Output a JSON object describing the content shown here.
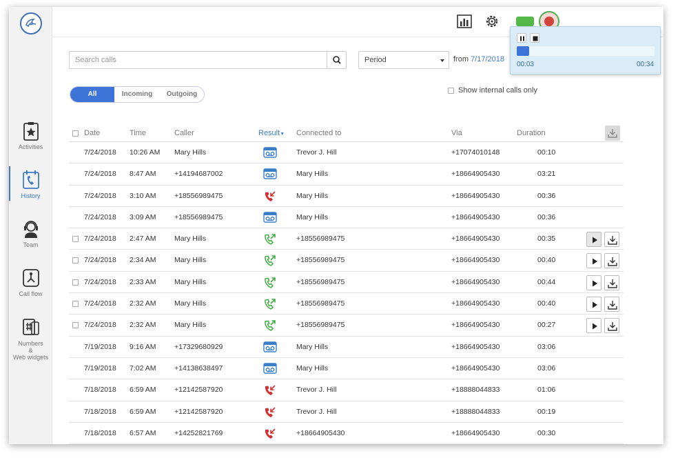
{
  "nav": [
    {
      "label": "Activities",
      "icon": "star-clipboard-icon"
    },
    {
      "label": "History",
      "icon": "phone-calendar-icon",
      "active": true
    },
    {
      "label": "Team",
      "icon": "headset-agent-icon"
    },
    {
      "label": "Call flow",
      "icon": "call-flow-icon"
    },
    {
      "label": "Numbers & Web widgets",
      "label_lines": [
        "Numbers",
        "&",
        "Web widgets"
      ],
      "icon": "hash-phone-icon"
    }
  ],
  "search": {
    "placeholder": "Search calls"
  },
  "period": {
    "label": "Period"
  },
  "from": {
    "prefix": "from",
    "date": "7/17/2018"
  },
  "tabs": {
    "all": "All",
    "incoming": "Incoming",
    "outgoing": "Outgoing"
  },
  "internal_only": "Show internal calls only",
  "columns": {
    "date": "Date",
    "time": "Time",
    "caller": "Caller",
    "result": "Result",
    "connected": "Connected to",
    "via": "Via",
    "duration": "Duration"
  },
  "player": {
    "current": "00:03",
    "total": "00:34",
    "progress": 0.09
  },
  "colors": {
    "accent": "#3e74d8",
    "voicemail": "#3a7dc9",
    "missed": "#d32f2f",
    "outgoing": "#3cae3f"
  },
  "rows": [
    {
      "date": "7/24/2018",
      "time": "10:26 AM",
      "caller": "Mary Hills",
      "result": "voicemail",
      "connected": "Trevor J. Hill",
      "via": "+17074010148",
      "duration": "00:10",
      "checkbox": false,
      "recording": false
    },
    {
      "date": "7/24/2018",
      "time": "8:47 AM",
      "caller": "+14194687002",
      "result": "voicemail",
      "connected": "Mary Hills",
      "via": "+18664905430",
      "duration": "03:21",
      "checkbox": false,
      "recording": false
    },
    {
      "date": "7/24/2018",
      "time": "3:10 AM",
      "caller": "+18556989475",
      "result": "missed",
      "connected": "Mary Hills",
      "via": "+18664905430",
      "duration": "00:36",
      "checkbox": false,
      "recording": false
    },
    {
      "date": "7/24/2018",
      "time": "3:09 AM",
      "caller": "+18556989475",
      "result": "voicemail",
      "connected": "Mary Hills",
      "via": "+18664905430",
      "duration": "00:36",
      "checkbox": false,
      "recording": false
    },
    {
      "date": "7/24/2018",
      "time": "2:47 AM",
      "caller": "Mary Hills",
      "result": "outgoing",
      "connected": "+18556989475",
      "via": "+18664905430",
      "duration": "00:35",
      "checkbox": true,
      "recording": true,
      "playing": true
    },
    {
      "date": "7/24/2018",
      "time": "2:34 AM",
      "caller": "Mary Hills",
      "result": "outgoing",
      "connected": "+18556989475",
      "via": "+18664905430",
      "duration": "00:40",
      "checkbox": true,
      "recording": true
    },
    {
      "date": "7/24/2018",
      "time": "2:33 AM",
      "caller": "Mary Hills",
      "result": "outgoing",
      "connected": "+18556989475",
      "via": "+18664905430",
      "duration": "00:44",
      "checkbox": true,
      "recording": true
    },
    {
      "date": "7/24/2018",
      "time": "2:32 AM",
      "caller": "Mary Hills",
      "result": "outgoing",
      "connected": "+18556989475",
      "via": "+18664905430",
      "duration": "00:40",
      "checkbox": true,
      "recording": true
    },
    {
      "date": "7/24/2018",
      "time": "2:32 AM",
      "caller": "Mary Hills",
      "result": "outgoing",
      "connected": "+18556989475",
      "via": "+18664905430",
      "duration": "00:27",
      "checkbox": true,
      "recording": true
    },
    {
      "date": "7/19/2018",
      "time": "9:16 AM",
      "caller": "+17329680929",
      "result": "voicemail",
      "connected": "Mary Hills",
      "via": "+18664905430",
      "duration": "03:06",
      "checkbox": false,
      "recording": false
    },
    {
      "date": "7/19/2018",
      "time": "7:02 AM",
      "caller": "+14138638497",
      "result": "voicemail",
      "connected": "Mary Hills",
      "via": "+18664905430",
      "duration": "03:06",
      "checkbox": false,
      "recording": false
    },
    {
      "date": "7/18/2018",
      "time": "6:59 AM",
      "caller": "+12142587920",
      "result": "missed",
      "connected": "Trevor J. Hill",
      "via": "+18888044833",
      "duration": "01:06",
      "checkbox": false,
      "recording": false
    },
    {
      "date": "7/18/2018",
      "time": "6:59 AM",
      "caller": "+12142587920",
      "result": "missed",
      "connected": "Trevor J. Hill",
      "via": "+18888044833",
      "duration": "00:19",
      "checkbox": false,
      "recording": false
    },
    {
      "date": "7/18/2018",
      "time": "6:57 AM",
      "caller": "+14252821769",
      "result": "missed",
      "connected": "+18664905430",
      "via": "+18664905430",
      "duration": "00:30",
      "checkbox": false,
      "recording": false
    }
  ]
}
